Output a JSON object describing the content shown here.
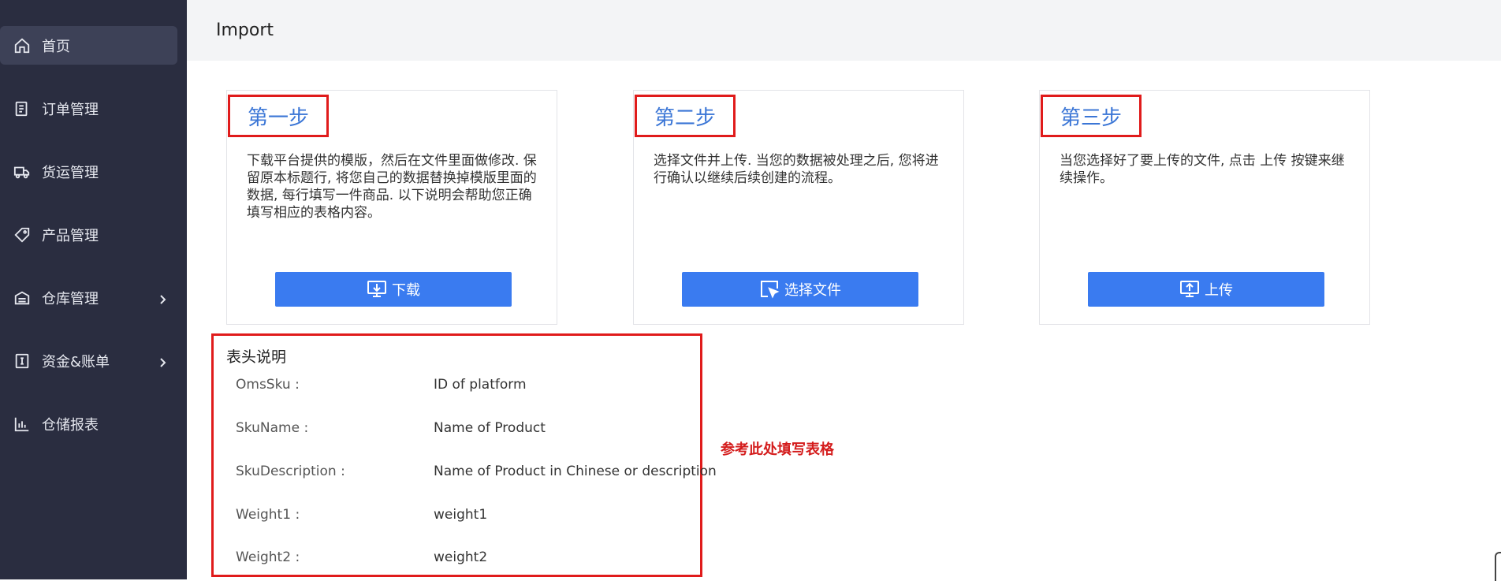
{
  "sidebar": {
    "items": [
      {
        "label": "首页",
        "icon": "home-icon",
        "active": true
      },
      {
        "label": "订单管理",
        "icon": "order-icon"
      },
      {
        "label": "货运管理",
        "icon": "truck-icon"
      },
      {
        "label": "产品管理",
        "icon": "tag-icon"
      },
      {
        "label": "仓库管理",
        "icon": "warehouse-icon",
        "expandable": true
      },
      {
        "label": "资金&账单",
        "icon": "bill-icon",
        "expandable": true
      },
      {
        "label": "仓储报表",
        "icon": "chart-icon"
      }
    ]
  },
  "header": {
    "title": "Import"
  },
  "steps": [
    {
      "title": "第一步",
      "description": "下载平台提供的模版，然后在文件里面做修改. 保留原本标题行, 将您自己的数据替换掉模版里面的数据, 每行填写一件商品. 以下说明会帮助您正确填写相应的表格内容。",
      "button": "下载",
      "icon": "download-icon"
    },
    {
      "title": "第二步",
      "description": "选择文件并上传. 当您的数据被处理之后, 您将进行确认以继续后续创建的流程。",
      "button": "选择文件",
      "icon": "select-file-icon"
    },
    {
      "title": "第三步",
      "description": "当您选择好了要上传的文件, 点击 上传 按键来继续操作。",
      "button": "上传",
      "icon": "upload-icon"
    }
  ],
  "fields": {
    "title": "表头说明",
    "rows": [
      {
        "key": "OmsSku :",
        "value": "ID of platform"
      },
      {
        "key": "SkuName :",
        "value": "Name of Product"
      },
      {
        "key": "SkuDescription :",
        "value": "Name of Product in Chinese or description"
      },
      {
        "key": "Weight1 :",
        "value": "weight1"
      },
      {
        "key": "Weight2 :",
        "value": "weight2"
      }
    ]
  },
  "note": "参考此处填写表格",
  "colors": {
    "sidebar": "#2a2d40",
    "accent": "#3a7bf0",
    "highlight": "#e01b1b"
  }
}
